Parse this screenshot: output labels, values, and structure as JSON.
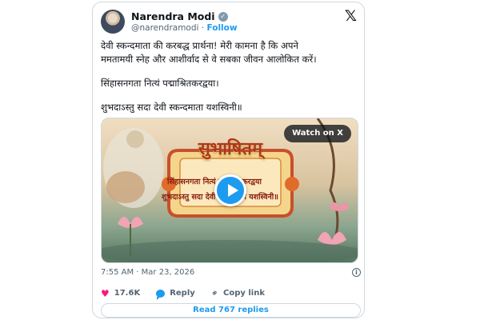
{
  "tweet": {
    "author_name": "Narendra Modi",
    "verified_mark": "✓",
    "handle": "@narendramodi",
    "separator": "·",
    "follow_label": "Follow",
    "x_logo": "𝕏",
    "text_lines": [
      "देवी स्कन्दमाता की करबद्ध प्रार्थना! मेरी कामना है कि अपने",
      "ममतामयी स्नेह और आशीर्वाद से वे सबका जीवन आलोकित करें।",
      "सिंहासनगता नित्यं पद्माश्रितकरद्वया।",
      "शुभदाऽस्तु सदा देवी स्कन्दमाता यशस्विनी॥"
    ]
  },
  "media": {
    "watch_label": "Watch on X",
    "title_word": "सुभाषितम्",
    "verse_line1": "सिंहासनगता नित्यं पद्माश्रितकरद्वया",
    "verse_line2": "शुभदाऽस्तु सदा देवी स्कन्दमाता यशस्विनी॥",
    "play_icon": "play-icon"
  },
  "meta": {
    "time": "7:55 AM",
    "separator": "·",
    "date": "Mar 23, 2026",
    "info_icon": "i"
  },
  "actions": {
    "like_count": "17.6K",
    "reply_label": "Reply",
    "copy_link_label": "Copy link",
    "heart_glyph": "♥",
    "link_glyph": "⚭"
  },
  "replies_button_label": "Read 767 replies",
  "colors": {
    "accent": "#1d9bf0",
    "like": "#f91880",
    "muted": "#536471",
    "border": "#cfd9de"
  }
}
